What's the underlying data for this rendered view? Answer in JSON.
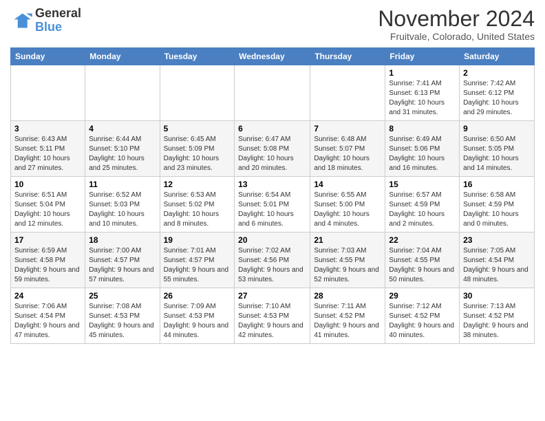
{
  "logo": {
    "line1": "General",
    "line2": "Blue"
  },
  "title": "November 2024",
  "location": "Fruitvale, Colorado, United States",
  "days_of_week": [
    "Sunday",
    "Monday",
    "Tuesday",
    "Wednesday",
    "Thursday",
    "Friday",
    "Saturday"
  ],
  "weeks": [
    [
      {
        "day": "",
        "info": ""
      },
      {
        "day": "",
        "info": ""
      },
      {
        "day": "",
        "info": ""
      },
      {
        "day": "",
        "info": ""
      },
      {
        "day": "",
        "info": ""
      },
      {
        "day": "1",
        "info": "Sunrise: 7:41 AM\nSunset: 6:13 PM\nDaylight: 10 hours and 31 minutes."
      },
      {
        "day": "2",
        "info": "Sunrise: 7:42 AM\nSunset: 6:12 PM\nDaylight: 10 hours and 29 minutes."
      }
    ],
    [
      {
        "day": "3",
        "info": "Sunrise: 6:43 AM\nSunset: 5:11 PM\nDaylight: 10 hours and 27 minutes."
      },
      {
        "day": "4",
        "info": "Sunrise: 6:44 AM\nSunset: 5:10 PM\nDaylight: 10 hours and 25 minutes."
      },
      {
        "day": "5",
        "info": "Sunrise: 6:45 AM\nSunset: 5:09 PM\nDaylight: 10 hours and 23 minutes."
      },
      {
        "day": "6",
        "info": "Sunrise: 6:47 AM\nSunset: 5:08 PM\nDaylight: 10 hours and 20 minutes."
      },
      {
        "day": "7",
        "info": "Sunrise: 6:48 AM\nSunset: 5:07 PM\nDaylight: 10 hours and 18 minutes."
      },
      {
        "day": "8",
        "info": "Sunrise: 6:49 AM\nSunset: 5:06 PM\nDaylight: 10 hours and 16 minutes."
      },
      {
        "day": "9",
        "info": "Sunrise: 6:50 AM\nSunset: 5:05 PM\nDaylight: 10 hours and 14 minutes."
      }
    ],
    [
      {
        "day": "10",
        "info": "Sunrise: 6:51 AM\nSunset: 5:04 PM\nDaylight: 10 hours and 12 minutes."
      },
      {
        "day": "11",
        "info": "Sunrise: 6:52 AM\nSunset: 5:03 PM\nDaylight: 10 hours and 10 minutes."
      },
      {
        "day": "12",
        "info": "Sunrise: 6:53 AM\nSunset: 5:02 PM\nDaylight: 10 hours and 8 minutes."
      },
      {
        "day": "13",
        "info": "Sunrise: 6:54 AM\nSunset: 5:01 PM\nDaylight: 10 hours and 6 minutes."
      },
      {
        "day": "14",
        "info": "Sunrise: 6:55 AM\nSunset: 5:00 PM\nDaylight: 10 hours and 4 minutes."
      },
      {
        "day": "15",
        "info": "Sunrise: 6:57 AM\nSunset: 4:59 PM\nDaylight: 10 hours and 2 minutes."
      },
      {
        "day": "16",
        "info": "Sunrise: 6:58 AM\nSunset: 4:59 PM\nDaylight: 10 hours and 0 minutes."
      }
    ],
    [
      {
        "day": "17",
        "info": "Sunrise: 6:59 AM\nSunset: 4:58 PM\nDaylight: 9 hours and 59 minutes."
      },
      {
        "day": "18",
        "info": "Sunrise: 7:00 AM\nSunset: 4:57 PM\nDaylight: 9 hours and 57 minutes."
      },
      {
        "day": "19",
        "info": "Sunrise: 7:01 AM\nSunset: 4:57 PM\nDaylight: 9 hours and 55 minutes."
      },
      {
        "day": "20",
        "info": "Sunrise: 7:02 AM\nSunset: 4:56 PM\nDaylight: 9 hours and 53 minutes."
      },
      {
        "day": "21",
        "info": "Sunrise: 7:03 AM\nSunset: 4:55 PM\nDaylight: 9 hours and 52 minutes."
      },
      {
        "day": "22",
        "info": "Sunrise: 7:04 AM\nSunset: 4:55 PM\nDaylight: 9 hours and 50 minutes."
      },
      {
        "day": "23",
        "info": "Sunrise: 7:05 AM\nSunset: 4:54 PM\nDaylight: 9 hours and 48 minutes."
      }
    ],
    [
      {
        "day": "24",
        "info": "Sunrise: 7:06 AM\nSunset: 4:54 PM\nDaylight: 9 hours and 47 minutes."
      },
      {
        "day": "25",
        "info": "Sunrise: 7:08 AM\nSunset: 4:53 PM\nDaylight: 9 hours and 45 minutes."
      },
      {
        "day": "26",
        "info": "Sunrise: 7:09 AM\nSunset: 4:53 PM\nDaylight: 9 hours and 44 minutes."
      },
      {
        "day": "27",
        "info": "Sunrise: 7:10 AM\nSunset: 4:53 PM\nDaylight: 9 hours and 42 minutes."
      },
      {
        "day": "28",
        "info": "Sunrise: 7:11 AM\nSunset: 4:52 PM\nDaylight: 9 hours and 41 minutes."
      },
      {
        "day": "29",
        "info": "Sunrise: 7:12 AM\nSunset: 4:52 PM\nDaylight: 9 hours and 40 minutes."
      },
      {
        "day": "30",
        "info": "Sunrise: 7:13 AM\nSunset: 4:52 PM\nDaylight: 9 hours and 38 minutes."
      }
    ]
  ]
}
